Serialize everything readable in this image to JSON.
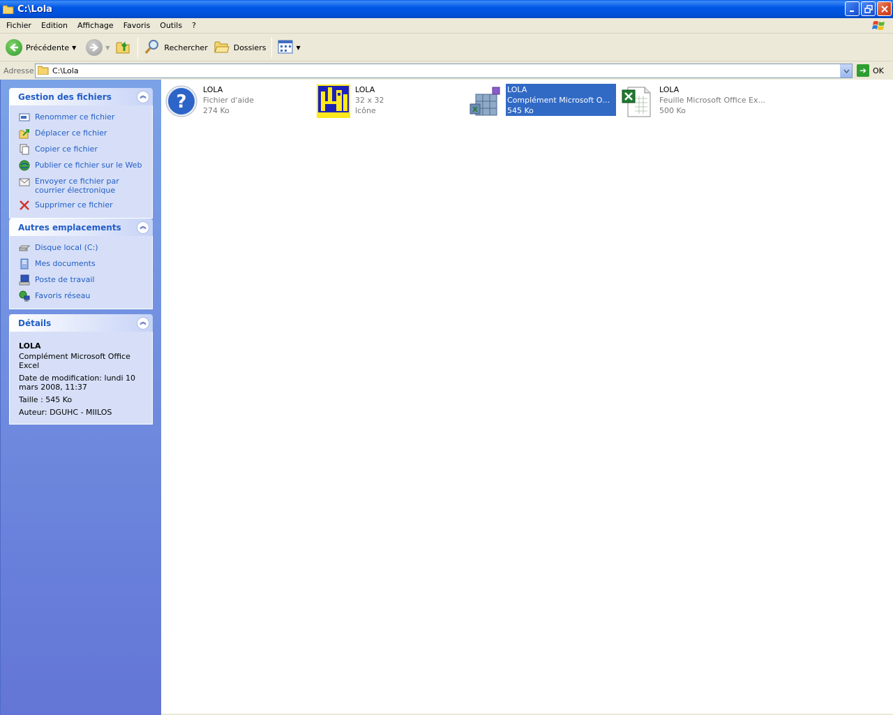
{
  "window": {
    "title": "C:\\Lola"
  },
  "menu": [
    "Fichier",
    "Edition",
    "Affichage",
    "Favoris",
    "Outils",
    "?"
  ],
  "toolbar": {
    "back_label": "Précédente",
    "search_label": "Rechercher",
    "folders_label": "Dossiers"
  },
  "address": {
    "label": "Adresse",
    "value": "C:\\Lola",
    "go_label": "OK"
  },
  "sidebar": {
    "file_tasks": {
      "title": "Gestion des fichiers",
      "items": [
        {
          "label": "Renommer ce fichier",
          "icon": "rename-icon"
        },
        {
          "label": "Déplacer ce fichier",
          "icon": "move-icon"
        },
        {
          "label": "Copier ce fichier",
          "icon": "copy-icon"
        },
        {
          "label": "Publier ce fichier sur le Web",
          "icon": "publish-web-icon"
        },
        {
          "label": "Envoyer ce fichier par courrier électronique",
          "icon": "email-icon"
        },
        {
          "label": "Supprimer ce fichier",
          "icon": "delete-icon"
        }
      ]
    },
    "other_places": {
      "title": "Autres emplacements",
      "items": [
        {
          "label": "Disque local (C:)",
          "icon": "drive-icon"
        },
        {
          "label": "Mes documents",
          "icon": "documents-icon"
        },
        {
          "label": "Poste de travail",
          "icon": "computer-icon"
        },
        {
          "label": "Favoris réseau",
          "icon": "network-icon"
        }
      ]
    },
    "details": {
      "title": "Détails",
      "name": "LOLA",
      "type": "Complément Microsoft Office Excel",
      "modified": "Date de modification: lundi 10 mars 2008, 11:37",
      "size": "Taille : 545 Ko",
      "author": "Auteur: DGUHC - MIILOS"
    }
  },
  "files": [
    {
      "name": "LOLA",
      "type": "Fichier d'aide",
      "size": "274 Ko",
      "icon": "help-file-icon",
      "selected": false
    },
    {
      "name": "LOLA",
      "type": "32 x 32",
      "size": "Icône",
      "icon": "icon-file-icon",
      "selected": false
    },
    {
      "name": "LOLA",
      "type": "Complément Microsoft Offic...",
      "size": "545 Ko",
      "icon": "excel-addin-icon",
      "selected": true
    },
    {
      "name": "LOLA",
      "type": "Feuille Microsoft Office Ex...",
      "size": "500 Ko",
      "icon": "excel-sheet-icon",
      "selected": false
    }
  ],
  "colors": {
    "titlebar": "#0058E6",
    "sidebar_top": "#7BA2E7",
    "sidebar_bottom": "#6375D6",
    "link": "#215DC6",
    "selection": "#316AC5"
  }
}
